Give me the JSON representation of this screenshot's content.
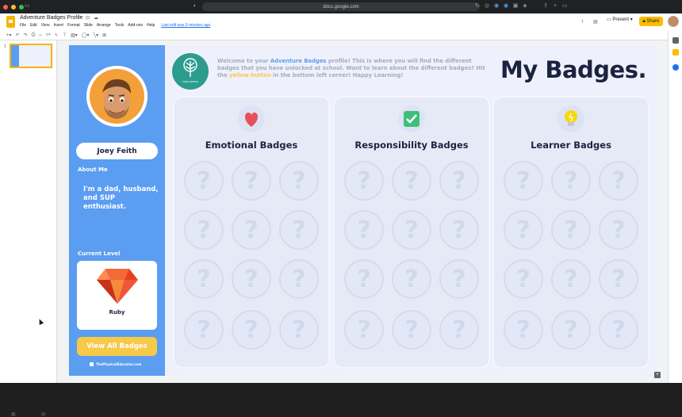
{
  "browser": {
    "url": "docs.google.com"
  },
  "doc": {
    "title": "Adventure Badges Profile",
    "menu": [
      "File",
      "Edit",
      "View",
      "Insert",
      "Format",
      "Slide",
      "Arrange",
      "Tools",
      "Add-ons",
      "Help"
    ],
    "last_edit": "Last edit was 9 minutes ago",
    "present_label": "Present",
    "share_label": "Share"
  },
  "filmstrip": {
    "slide_number": "1"
  },
  "slide": {
    "welcome": {
      "part1": "Welcome to your ",
      "brand": "Adventure Badges",
      "part2": " profile! This is where you will find the different badges that you have unlocked at school. Want to learn about the different badges? Hit the ",
      "button_word": "yellow button",
      "part3": " in the bottom left corner! Happy Learning!"
    },
    "heading": "My Badges.",
    "school_logo_text": "TREE SPRING",
    "profile": {
      "name": "Joey Feith",
      "about_label": "About Me",
      "about_text": "I'm a dad, husband, and SUP enthusiast.",
      "level_label": "Current Level",
      "level_name": "Ruby",
      "view_all_label": "View All Badges",
      "credit": "ThePhysicalEducator.com"
    },
    "columns": [
      {
        "title": "Emotional Badges",
        "icon": "heart-icon",
        "color": "#e8505b"
      },
      {
        "title": "Responsibility Badges",
        "icon": "checkmark-icon",
        "color": "#3dbf7a"
      },
      {
        "title": "Learner Badges",
        "icon": "lightbulb-icon",
        "color": "#f5d90a"
      }
    ],
    "slot_glyph": "?"
  },
  "colors": {
    "sidebar": "#5b9df1",
    "accent_yellow": "#f7c948",
    "navy": "#1c2340",
    "ruby": "#e8411f"
  }
}
